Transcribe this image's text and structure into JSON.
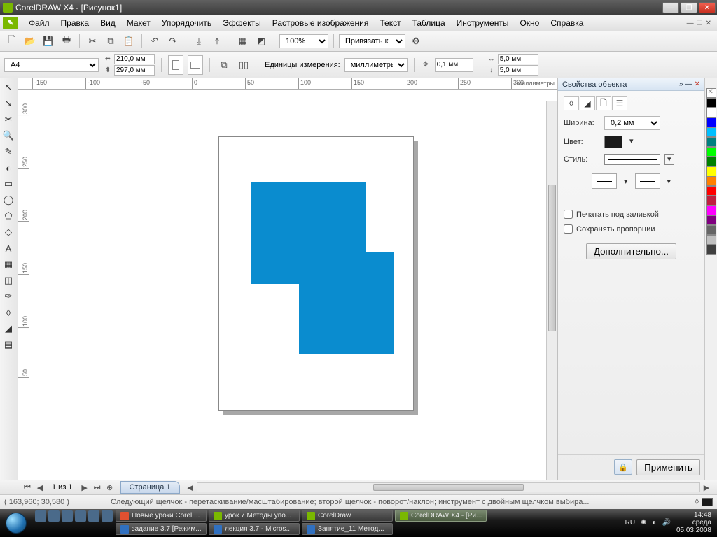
{
  "window": {
    "title": "CorelDRAW X4 - [Рисунок1]"
  },
  "menu": {
    "file": "Файл",
    "edit": "Правка",
    "view": "Вид",
    "layout": "Макет",
    "arrange": "Упорядочить",
    "effects": "Эффекты",
    "bitmaps": "Растровые изображения",
    "text": "Текст",
    "table": "Таблица",
    "tools": "Инструменты",
    "window": "Окно",
    "help": "Справка"
  },
  "toolbar": {
    "zoom": "100%",
    "snap_label": "Привязать к"
  },
  "propbar": {
    "page_format": "A4",
    "width": "210,0 мм",
    "height": "297,0 мм",
    "units_label": "Единицы измерения:",
    "units_value": "миллиметры",
    "nudge": "0,1 мм",
    "dup_x": "5,0 мм",
    "dup_y": "5,0 мм"
  },
  "ruler": {
    "units_label": "миллиметры",
    "h_ticks": [
      "-150",
      "-100",
      "-50",
      "0",
      "50",
      "100",
      "150",
      "200",
      "250",
      "300"
    ],
    "v_ticks": [
      "300",
      "250",
      "200",
      "150",
      "100",
      "50"
    ]
  },
  "pagebar": {
    "counter": "1 из 1",
    "tab": "Страница 1"
  },
  "docker": {
    "title": "Свойства объекта",
    "width_label": "Ширина:",
    "width_value": "0,2 мм",
    "color_label": "Цвет:",
    "style_label": "Стиль:",
    "print_under": "Печатать под заливкой",
    "keep_ratio": "Сохранять пропорции",
    "more": "Дополнительно...",
    "apply": "Применить"
  },
  "status": {
    "coords": "( 163,960; 30,580 )",
    "hint": "Следующий щелчок - перетаскивание/масштабирование; второй щелчок - поворот/наклон; инструмент с двойным щелчком выбира..."
  },
  "taskbar": {
    "lang": "RU",
    "time": "14:48",
    "day": "среда",
    "date": "05.03.2008",
    "items_top": [
      "Новые уроки Corel ...",
      "урок 7 Методы упо...",
      "CorelDraw",
      "CorelDRAW X4 - [Ри..."
    ],
    "items_bottom": [
      "задание 3.7 [Режим...",
      "лекция 3.7 - Micros...",
      "Занятие_11 Метод..."
    ]
  },
  "colors": [
    "#000000",
    "#ffffff",
    "#0000ff",
    "#00bfff",
    "#008080",
    "#00ff00",
    "#008000",
    "#ffff00",
    "#ff8000",
    "#ff0000",
    "#c02040",
    "#ff00ff",
    "#800080",
    "#666666",
    "#c0c0c0",
    "#404040"
  ]
}
